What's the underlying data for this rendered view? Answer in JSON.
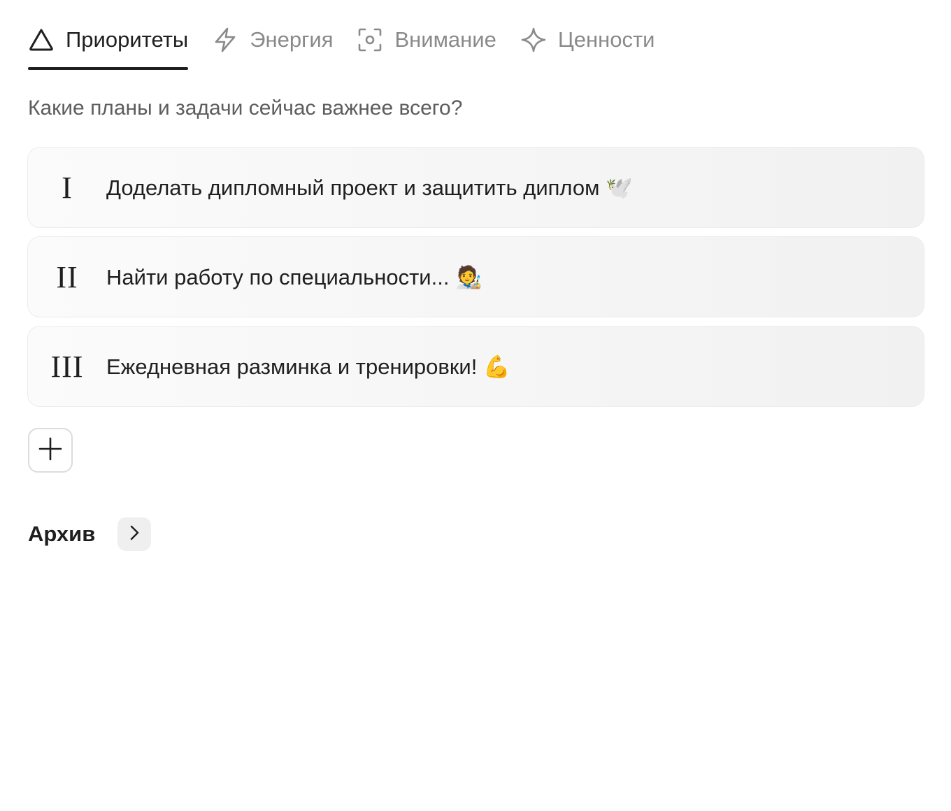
{
  "tabs": [
    {
      "label": "Приоритеты",
      "icon": "triangle-icon",
      "active": true
    },
    {
      "label": "Энергия",
      "icon": "lightning-icon",
      "active": false
    },
    {
      "label": "Внимание",
      "icon": "focus-icon",
      "active": false
    },
    {
      "label": "Ценности",
      "icon": "sparkle-icon",
      "active": false
    }
  ],
  "question": "Какие планы и задачи сейчас важнее всего?",
  "priorities": [
    {
      "numeral": "I",
      "text": "Доделать дипломный проект и защитить диплом 🕊️"
    },
    {
      "numeral": "II",
      "text": "Найти работу по специальности... 🧑‍🎨"
    },
    {
      "numeral": "III",
      "text": "Ежедневная разминка и тренировки! 💪"
    }
  ],
  "add_button_icon": "plus-icon",
  "archive": {
    "label": "Архив",
    "icon": "chevron-right-icon"
  },
  "colors": {
    "text": "#1f1f1f",
    "muted": "#8a8a8a",
    "card_bg": "#f4f4f4"
  }
}
